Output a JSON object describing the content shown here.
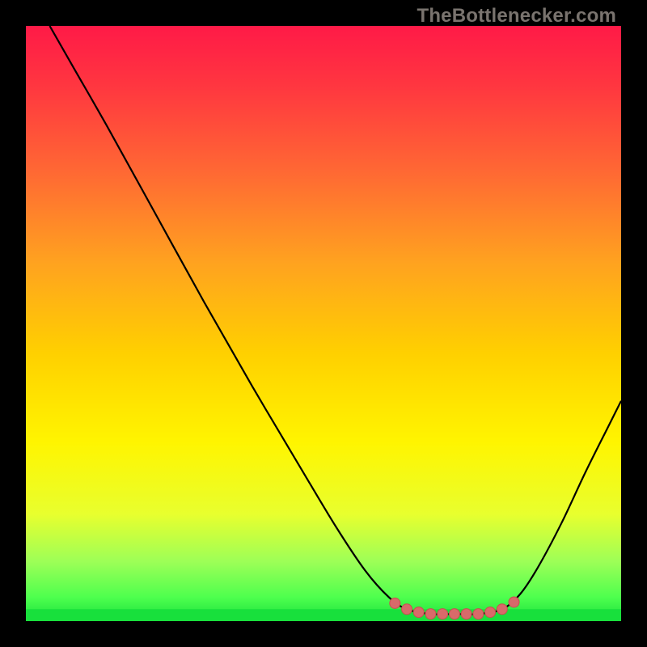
{
  "watermark": "TheBottlenecker.com",
  "colors": {
    "black": "#000000",
    "stroke": "#000000",
    "marker": "#d86a6a",
    "marker_stroke": "#c94f4f",
    "green": "#18e03c",
    "watermark": "#79736e"
  },
  "chart_data": {
    "type": "line",
    "title": "",
    "xlabel": "",
    "ylabel": "",
    "xlim": [
      0,
      100
    ],
    "ylim": [
      0,
      100
    ],
    "gradient_stops": [
      {
        "offset": 0.0,
        "color": "#ff1a47"
      },
      {
        "offset": 0.1,
        "color": "#ff3640"
      },
      {
        "offset": 0.25,
        "color": "#ff6a33"
      },
      {
        "offset": 0.4,
        "color": "#ffa31f"
      },
      {
        "offset": 0.55,
        "color": "#ffd000"
      },
      {
        "offset": 0.7,
        "color": "#fff500"
      },
      {
        "offset": 0.82,
        "color": "#e8ff2e"
      },
      {
        "offset": 0.9,
        "color": "#9dff57"
      },
      {
        "offset": 0.96,
        "color": "#4eff4e"
      },
      {
        "offset": 1.0,
        "color": "#18e03c"
      }
    ],
    "curve": [
      {
        "x": 4.0,
        "y": 100.0
      },
      {
        "x": 8.0,
        "y": 93.0
      },
      {
        "x": 14.0,
        "y": 82.5
      },
      {
        "x": 22.0,
        "y": 68.0
      },
      {
        "x": 30.0,
        "y": 53.5
      },
      {
        "x": 38.0,
        "y": 39.5
      },
      {
        "x": 46.0,
        "y": 26.0
      },
      {
        "x": 52.0,
        "y": 16.0
      },
      {
        "x": 57.0,
        "y": 8.5
      },
      {
        "x": 61.0,
        "y": 4.0
      },
      {
        "x": 64.0,
        "y": 2.0
      },
      {
        "x": 68.0,
        "y": 1.2
      },
      {
        "x": 72.0,
        "y": 1.2
      },
      {
        "x": 76.0,
        "y": 1.2
      },
      {
        "x": 80.0,
        "y": 2.0
      },
      {
        "x": 83.0,
        "y": 4.5
      },
      {
        "x": 86.0,
        "y": 9.0
      },
      {
        "x": 90.0,
        "y": 16.5
      },
      {
        "x": 94.0,
        "y": 25.0
      },
      {
        "x": 98.0,
        "y": 33.0
      },
      {
        "x": 100.0,
        "y": 37.0
      }
    ],
    "markers_range": {
      "x_start": 62.0,
      "x_end": 82.0
    },
    "markers": [
      {
        "x": 62.0,
        "y": 3.0
      },
      {
        "x": 64.0,
        "y": 2.0
      },
      {
        "x": 66.0,
        "y": 1.5
      },
      {
        "x": 68.0,
        "y": 1.2
      },
      {
        "x": 70.0,
        "y": 1.2
      },
      {
        "x": 72.0,
        "y": 1.2
      },
      {
        "x": 74.0,
        "y": 1.2
      },
      {
        "x": 76.0,
        "y": 1.2
      },
      {
        "x": 78.0,
        "y": 1.5
      },
      {
        "x": 80.0,
        "y": 2.0
      },
      {
        "x": 82.0,
        "y": 3.2
      }
    ]
  }
}
